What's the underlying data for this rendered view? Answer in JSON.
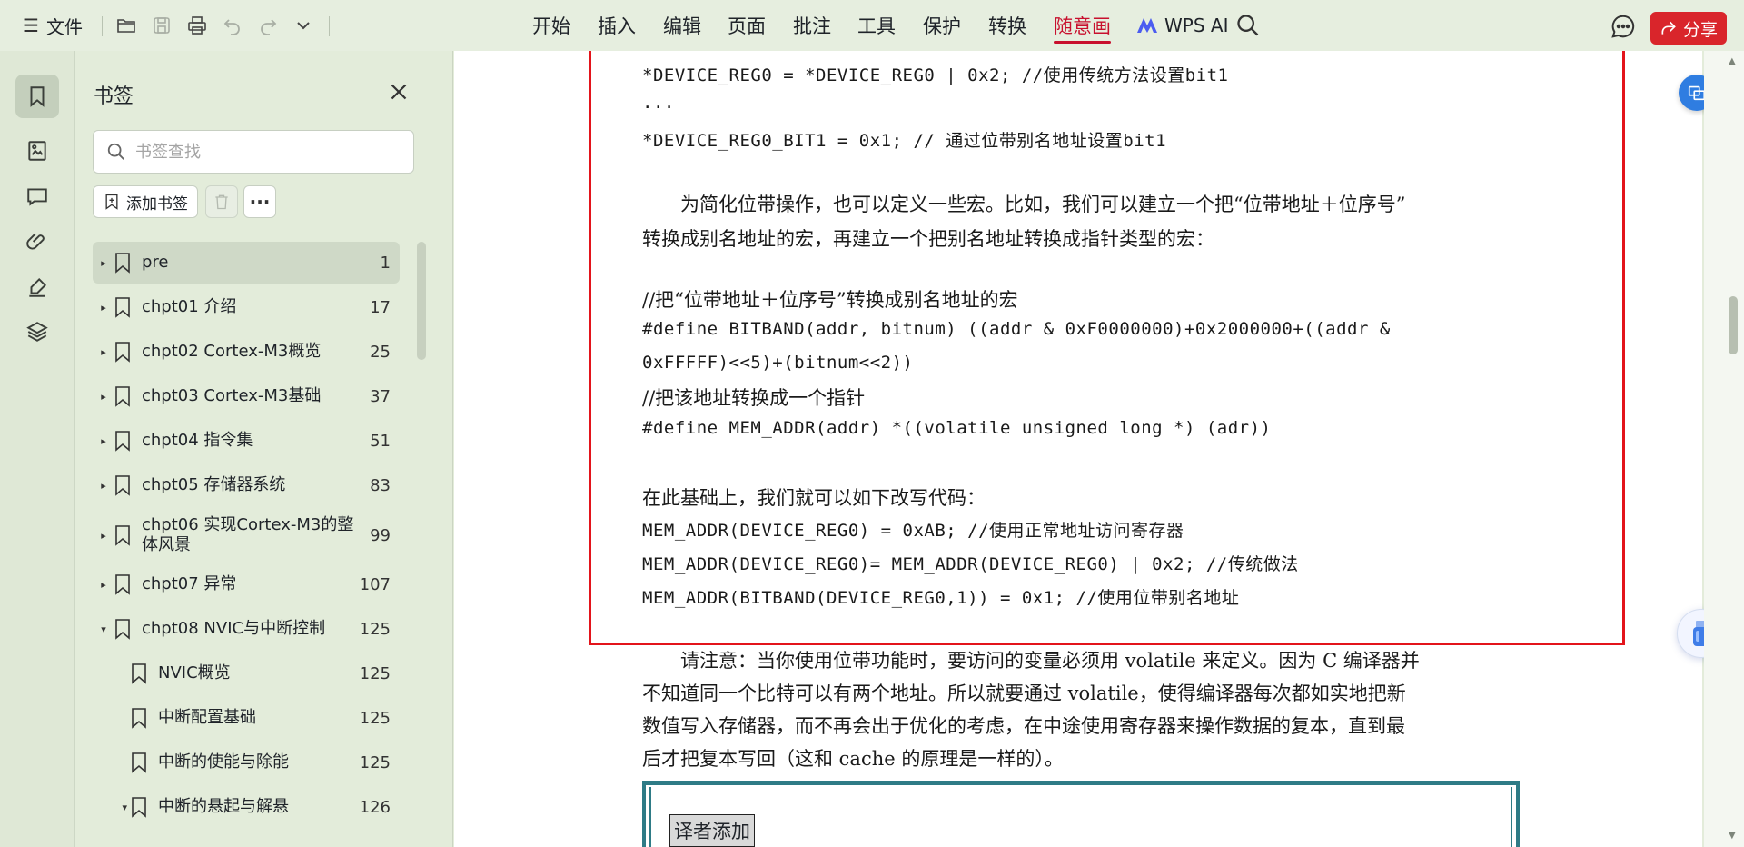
{
  "toolbar": {
    "file_menu": "文件",
    "ribbon_tabs": [
      "开始",
      "插入",
      "编辑",
      "页面",
      "批注",
      "工具",
      "保护",
      "转换",
      "随意画"
    ],
    "active_tab": "随意画",
    "wps_ai": "WPS AI",
    "share": "分享",
    "accent_color": "#c8102e"
  },
  "rail": {
    "icons": [
      "bookmark-icon",
      "image-icon",
      "comment-icon",
      "attachment-icon",
      "signature-icon",
      "layers-icon"
    ],
    "active": "bookmark-icon"
  },
  "bookmarks": {
    "title": "书签",
    "search_placeholder": "书签查找",
    "add_label": "添加书签",
    "items": [
      {
        "label": "pre",
        "page": "1",
        "caret": "▸"
      },
      {
        "label": "chpt01  介绍",
        "page": "17",
        "caret": "▸"
      },
      {
        "label": "chpt02  Cortex-M3概览",
        "page": "25",
        "caret": "▸"
      },
      {
        "label": "chpt03  Cortex-M3基础",
        "page": "37",
        "caret": "▸"
      },
      {
        "label": "chpt04  指令集",
        "page": "51",
        "caret": "▸"
      },
      {
        "label": "chpt05  存储器系统",
        "page": "83",
        "caret": "▸"
      },
      {
        "label": "chpt06  实现Cortex-M3的整体风景",
        "page": "99",
        "caret": "▸"
      },
      {
        "label": "chpt07  异常",
        "page": "107",
        "caret": "▸"
      },
      {
        "label": "chpt08  NVIC与中断控制",
        "page": "125",
        "caret": "▾"
      },
      {
        "label": "NVIC概览",
        "page": "125",
        "caret": ""
      },
      {
        "label": "中断配置基础",
        "page": "125",
        "caret": ""
      },
      {
        "label": "中断的使能与除能",
        "page": "125",
        "caret": ""
      },
      {
        "label": "中断的悬起与解悬",
        "page": "126",
        "caret": "▾"
      }
    ]
  },
  "document": {
    "lines": [
      "*DEVICE_REG0 = *DEVICE_REG0 | 0x2; //使用传统方法设置bit1",
      "...",
      "*DEVICE_REG0_BIT1 = 0x1;            // 通过位带别名地址设置bit1",
      "　　为简化位带操作，也可以定义一些宏。比如，我们可以建立一个把“位带地址＋位序号”",
      "转换成别名地址的宏，再建立一个把别名地址转换成指针类型的宏：",
      "//把“位带地址＋位序号”转换成别名地址的宏",
      "#define BITBAND(addr, bitnum) ((addr & 0xF0000000)+0x2000000+((addr &",
      "0xFFFFF)<<5)+(bitnum<<2))",
      "//把该地址转换成一个指针",
      "#define MEM_ADDR(addr) *((volatile unsigned long *) (adr))",
      "在此基础上，我们就可以如下改写代码：",
      "MEM_ADDR(DEVICE_REG0) = 0xAB;      //使用正常地址访问寄存器",
      "MEM_ADDR(DEVICE_REG0)= MEM_ADDR(DEVICE_REG0) | 0x2;  //传统做法",
      "MEM_ADDR(BITBAND(DEVICE_REG0,1)) = 0x1;              //使用位带别名地址",
      "　　请注意：当你使用位带功能时，要访问的变量必须用 volatile 来定义。因为 C 编译器并",
      "不知道同一个比特可以有两个地址。所以就要通过 volatile，使得编译器每次都如实地把新",
      "数值写入存储器，而不再会出于优化的考虑，在中途使用寄存器来操作数据的复本，直到最",
      "后才把复本写回（这和 cache 的原理是一样的）。"
    ],
    "note_label": "译者添加",
    "highlight_color": "#e3141b"
  }
}
